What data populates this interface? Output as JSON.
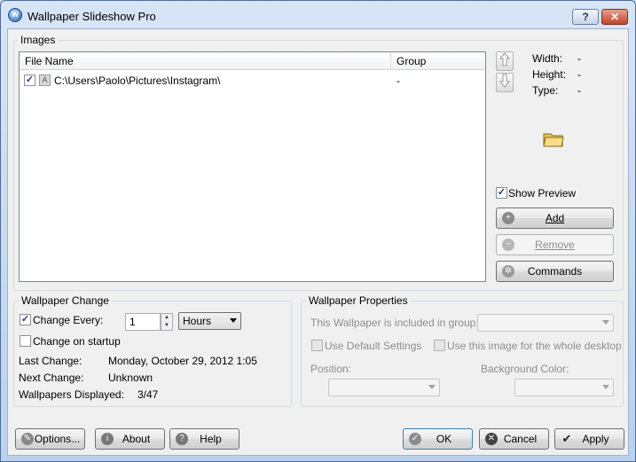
{
  "window": {
    "title": "Wallpaper Slideshow Pro",
    "help_btn": "?",
    "close_btn": "✕"
  },
  "images": {
    "group_label": "Images",
    "columns": [
      "File Name",
      "Group"
    ],
    "rows": [
      {
        "checked": true,
        "badge": "A",
        "path": "C:\\Users\\Paolo\\Pictures\\Instagram\\",
        "group": "-"
      }
    ],
    "info": {
      "width_label": "Width:",
      "width_value": "-",
      "height_label": "Height:",
      "height_value": "-",
      "type_label": "Type:",
      "type_value": "-"
    },
    "show_preview_label": "Show Preview",
    "show_preview_checked": true,
    "buttons": {
      "add": "Add",
      "remove": "Remove",
      "commands": "Commands"
    }
  },
  "wallpaper_change": {
    "group_label": "Wallpaper Change",
    "change_every_label": "Change Every:",
    "change_every_checked": true,
    "interval_value": "1",
    "interval_unit": "Hours",
    "change_on_startup_label": "Change on startup",
    "change_on_startup_checked": false,
    "last_change_label": "Last Change:",
    "last_change_value": "Monday, October 29, 2012 1:05",
    "next_change_label": "Next Change:",
    "next_change_value": "Unknown",
    "displayed_label": "Wallpapers Displayed:",
    "displayed_value": "3/47"
  },
  "wallpaper_properties": {
    "group_label": "Wallpaper Properties",
    "included_in_group_label": "This Wallpaper is included in group:",
    "use_default_label": "Use Default Settings",
    "whole_desktop_label": "Use this image for the whole desktop",
    "position_label": "Position:",
    "background_color_label": "Background Color:"
  },
  "footer": {
    "options": "Options...",
    "about": "About",
    "help": "Help",
    "ok": "OK",
    "cancel": "Cancel",
    "apply": "Apply"
  },
  "colors": {
    "title_bg": "#c9d9ee",
    "close": "#c3432a",
    "checkmark": "#1d3f73"
  }
}
